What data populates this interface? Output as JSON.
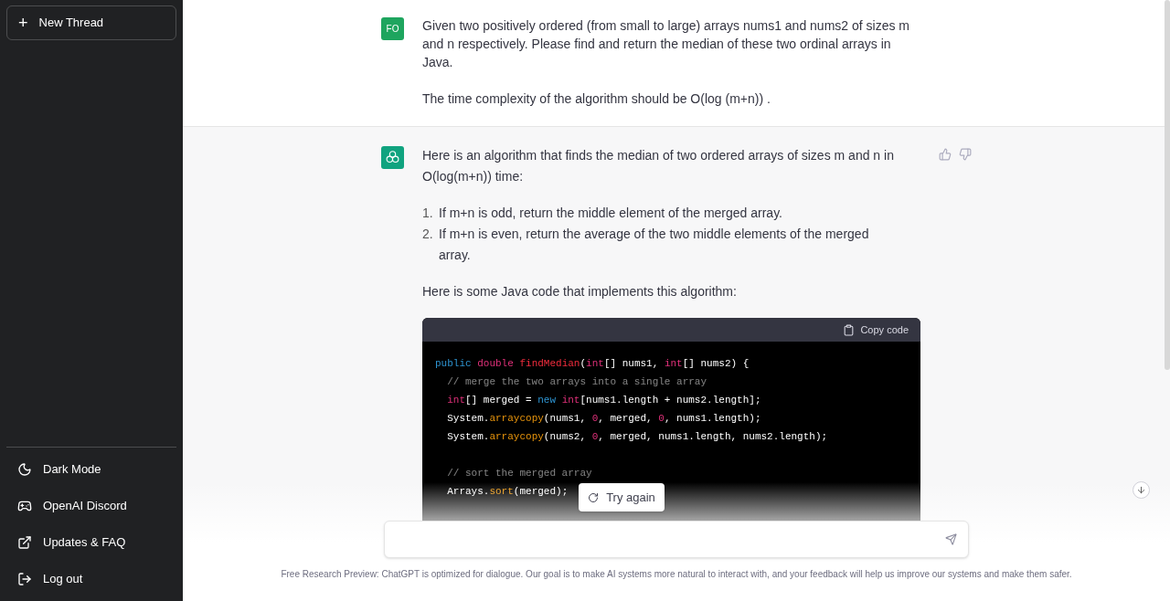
{
  "sidebar": {
    "new_thread": "New Thread",
    "plus_icon": "+",
    "items": [
      {
        "kind": "moon",
        "label": "Dark Mode"
      },
      {
        "kind": "discord",
        "label": "OpenAI Discord"
      },
      {
        "kind": "external",
        "label": "Updates & FAQ"
      },
      {
        "kind": "logout",
        "label": "Log out"
      }
    ]
  },
  "user_message": {
    "avatar": "FO",
    "paragraphs": [
      "Given two positively ordered (from small to large) arrays nums1 and nums2 of sizes m and n respectively. Please find and return the median of these two ordinal arrays in Java.",
      "The time complexity of the algorithm should be O(log (m+n)) ."
    ]
  },
  "assistant_message": {
    "intro": "Here is an algorithm that finds the median of two ordered arrays of sizes m and n in O(log(m+n)) time:",
    "steps": [
      {
        "number": "1.",
        "text": "If m+n is odd, return the middle element of the merged array."
      },
      {
        "number": "2.",
        "text": "If m+n is even, return the average of the two middle elements of the merged array."
      }
    ],
    "lead": "Here is some Java code that implements this algorithm:",
    "code": {
      "copy_label": "Copy code",
      "lines": [
        {
          "kind": "code",
          "tokens": [
            {
              "kind": "kw",
              "text": "public "
            },
            {
              "kind": "type",
              "text": "double "
            },
            {
              "kind": "fn",
              "text": "findMedian"
            },
            {
              "kind": "plain",
              "text": "("
            },
            {
              "kind": "type",
              "text": "int"
            },
            {
              "kind": "plain",
              "text": "[] nums1, "
            },
            {
              "kind": "type",
              "text": "int"
            },
            {
              "kind": "plain",
              "text": "[] nums2) {"
            }
          ]
        },
        {
          "kind": "code",
          "tokens": [
            {
              "kind": "comment",
              "text": "  // merge the two arrays into a single array"
            }
          ]
        },
        {
          "kind": "code",
          "tokens": [
            {
              "kind": "type",
              "text": "  int"
            },
            {
              "kind": "plain",
              "text": "[] merged = "
            },
            {
              "kind": "kw",
              "text": "new "
            },
            {
              "kind": "type",
              "text": "int"
            },
            {
              "kind": "plain",
              "text": "[nums1.length + nums2.length];"
            }
          ]
        },
        {
          "kind": "code",
          "tokens": [
            {
              "kind": "plain",
              "text": "  System."
            },
            {
              "kind": "method",
              "text": "arraycopy"
            },
            {
              "kind": "plain",
              "text": "(nums1, "
            },
            {
              "kind": "num",
              "text": "0"
            },
            {
              "kind": "plain",
              "text": ", merged, "
            },
            {
              "kind": "num",
              "text": "0"
            },
            {
              "kind": "plain",
              "text": ", nums1.length);"
            }
          ]
        },
        {
          "kind": "code",
          "tokens": [
            {
              "kind": "plain",
              "text": "  System."
            },
            {
              "kind": "method",
              "text": "arraycopy"
            },
            {
              "kind": "plain",
              "text": "(nums2, "
            },
            {
              "kind": "num",
              "text": "0"
            },
            {
              "kind": "plain",
              "text": ", merged, nums1.length, nums2.length);"
            }
          ]
        },
        {
          "kind": "blank"
        },
        {
          "kind": "code",
          "tokens": [
            {
              "kind": "comment",
              "text": "  // sort the merged array"
            }
          ]
        },
        {
          "kind": "code",
          "tokens": [
            {
              "kind": "plain",
              "text": "  Arrays."
            },
            {
              "kind": "method",
              "text": "sort"
            },
            {
              "kind": "plain",
              "text": "(merged);"
            }
          ]
        }
      ]
    }
  },
  "try_again": "Try again",
  "footer": "Free Research Preview: ChatGPT is optimized for dialogue. Our goal is to make AI systems more natural to interact with, and your feedback will help us improve our systems and make them safer."
}
